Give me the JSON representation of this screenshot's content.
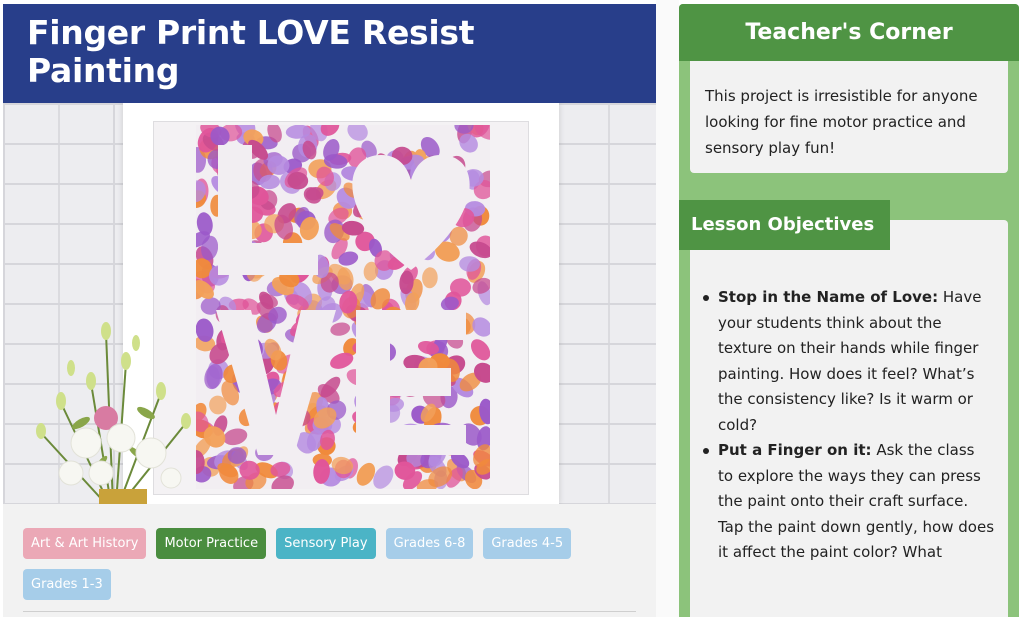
{
  "title": "Finger Print LOVE Resist Painting",
  "tags": [
    {
      "label": "Art & Art History",
      "color": "#eba8b6"
    },
    {
      "label": "Motor Practice",
      "color": "#4a8d3f"
    },
    {
      "label": "Sensory Play",
      "color": "#4bb4c6"
    },
    {
      "label": "Grades 6-8",
      "color": "#a6cde9"
    },
    {
      "label": "Grades 4-5",
      "color": "#a6cde9"
    },
    {
      "label": "Grades 1-3",
      "color": "#a6cde9"
    }
  ],
  "teachers_corner": {
    "heading": "Teacher's Corner",
    "text": "This project is irresistible for anyone looking for fine motor practice and sensory play fun!"
  },
  "lesson_objectives": {
    "heading": "Lesson Objectives",
    "items": [
      {
        "title": "Stop in the Name of Love:",
        "text": "Have your students think about the texture on their hands while finger painting. How does it feel? What’s the consistency like? Is it warm or cold?"
      },
      {
        "title": "Put a Finger on it:",
        "text": "Ask the class to explore the ways they can press the paint onto their craft surface. Tap the paint down gently, how does it affect the paint color? What"
      }
    ]
  },
  "colors": {
    "title_bg": "#283e8a",
    "panel_green": "#8cc37b",
    "header_green": "#4f9444",
    "paint_colors": [
      "#e0559a",
      "#9b59c9",
      "#f08a3c",
      "#c64a8e",
      "#b58be0",
      "#f2a05a"
    ]
  },
  "image_alt": "white frame with finger print LOVE painting beside vase of flowers on white brick wall"
}
